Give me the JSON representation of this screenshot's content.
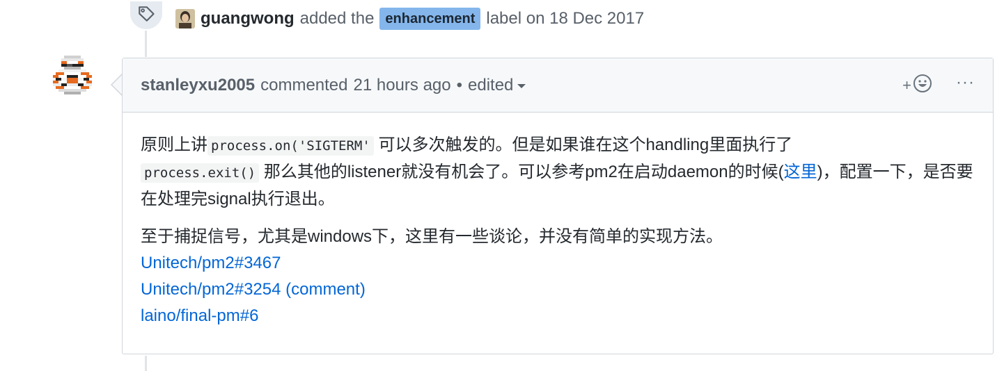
{
  "label_event": {
    "actor": "guangwong",
    "action": "added the",
    "label": "enhancement",
    "label_color": "#84b6eb",
    "suffix": "label on 18 Dec 2017",
    "icon": "tag-icon"
  },
  "comment": {
    "author": "stanleyxu2005",
    "action": "commented",
    "time": "21 hours ago",
    "separator": "•",
    "edited": "edited",
    "reaction_plus": "+",
    "more": "···",
    "paragraph1": {
      "t1": "原则上讲",
      "code1": "process.on('SIGTERM'",
      "t2": "可以多次触发的。但是如果谁在这个handling里面执行了",
      "code2": "process.exit()",
      "t3": "那么其他的listener就没有机会了。可以参考pm2在启动daemon的时候(",
      "link": "这里",
      "t4": ")，配置一下，是否要在处理完signal执行退出。"
    },
    "paragraph2": {
      "text": "至于捕捉信号，尤其是windows下，这里有一些谈论，并没有简单的实现方法。",
      "links": [
        "Unitech/pm2#3467",
        "Unitech/pm2#3254 (comment)",
        "laino/final-pm#6"
      ]
    }
  },
  "colors": {
    "link": "#0366d6",
    "header_bg": "#f6f8fa",
    "border": "#d1d5da"
  }
}
